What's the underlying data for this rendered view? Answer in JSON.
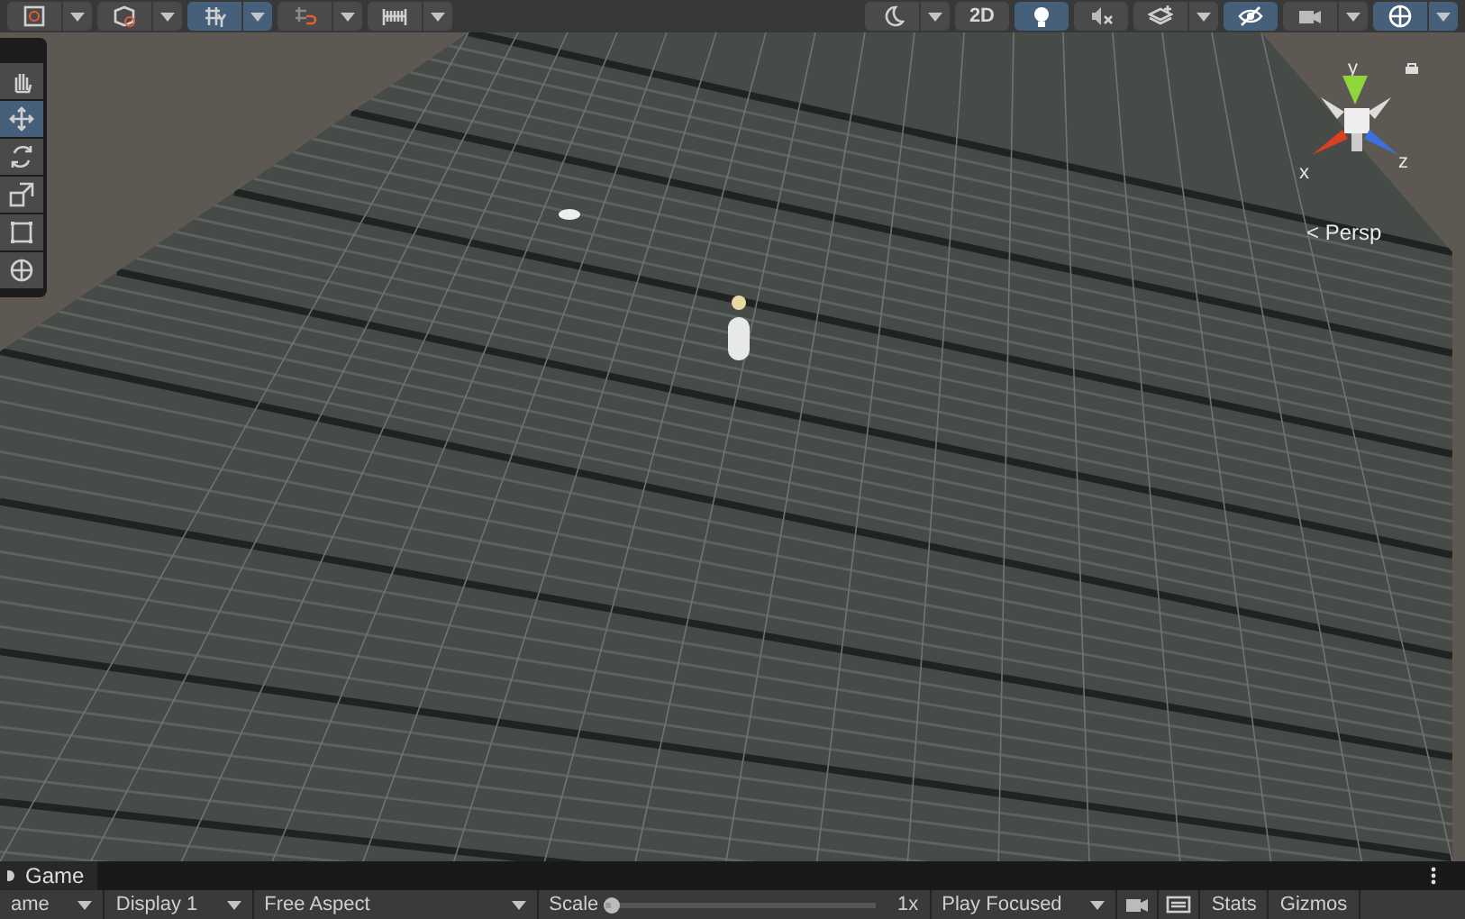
{
  "toolbar": {
    "left": [
      {
        "kind": "draw-mode",
        "on": false,
        "caret": true
      },
      {
        "kind": "cube",
        "on": false,
        "caret": true
      },
      {
        "kind": "grid-snap",
        "on": true,
        "caret": true
      },
      {
        "kind": "magnet",
        "on": false,
        "caret": true
      },
      {
        "kind": "ruler",
        "on": false,
        "caret": true
      }
    ],
    "right": [
      {
        "kind": "circle",
        "on": false,
        "caret": true
      },
      {
        "kind": "text",
        "label": "2D",
        "on": false,
        "caret": false
      },
      {
        "kind": "bulb",
        "on": true,
        "caret": false
      },
      {
        "kind": "speaker",
        "on": false,
        "caret": false
      },
      {
        "kind": "layers",
        "on": false,
        "caret": true
      },
      {
        "kind": "eye",
        "on": true,
        "caret": false
      },
      {
        "kind": "camera",
        "on": false,
        "caret": true
      },
      {
        "kind": "globe",
        "on": true,
        "caret": true
      }
    ]
  },
  "tools": [
    {
      "kind": "hand",
      "selected": false
    },
    {
      "kind": "move",
      "selected": true
    },
    {
      "kind": "rotate",
      "selected": false
    },
    {
      "kind": "scale",
      "selected": false
    },
    {
      "kind": "rect",
      "selected": false
    },
    {
      "kind": "transform",
      "selected": false
    }
  ],
  "gizmo": {
    "y": "y",
    "x": "x",
    "z": "z",
    "projection": "< Persp"
  },
  "game_panel": {
    "tab": "Game",
    "controls": [
      {
        "kind": "dropdown",
        "label": "ame",
        "wide": false
      },
      {
        "kind": "dropdown",
        "label": "Display 1",
        "wide": false
      },
      {
        "kind": "dropdown",
        "label": "Free Aspect",
        "wide": true
      },
      {
        "kind": "scale",
        "label": "Scale",
        "value": "1x",
        "level": 0.02
      },
      {
        "kind": "dropdown",
        "label": "Play Focused",
        "wide": false
      },
      {
        "kind": "speaker"
      },
      {
        "kind": "keyboard"
      },
      {
        "kind": "button",
        "label": "Stats"
      },
      {
        "kind": "button",
        "label": "Gizmos"
      }
    ]
  }
}
